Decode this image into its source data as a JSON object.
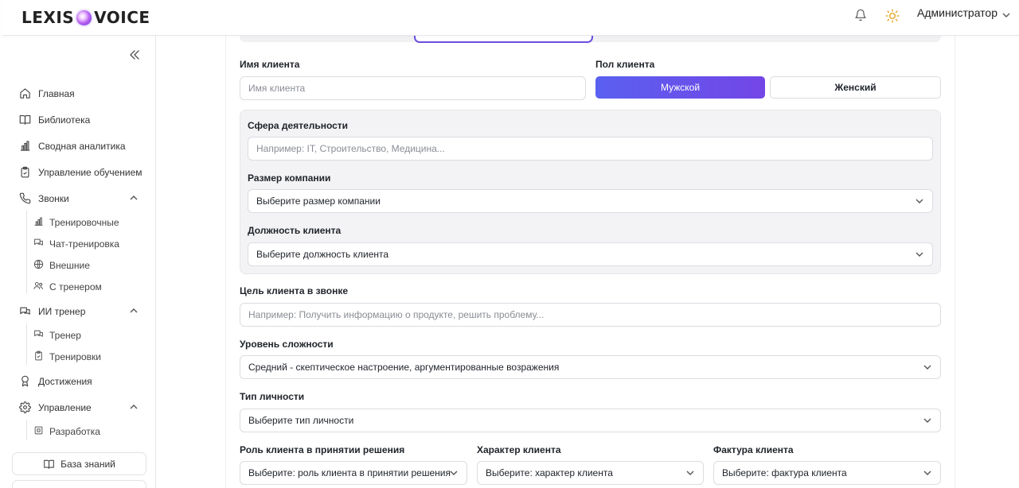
{
  "header": {
    "logo_left": "LEXIS",
    "logo_right": "VOICE",
    "user_name": "Администратор"
  },
  "sidebar": {
    "items": [
      {
        "label": "Главная",
        "icon": "home-icon"
      },
      {
        "label": "Библиотека",
        "icon": "book-icon"
      },
      {
        "label": "Сводная аналитика",
        "icon": "chart-icon"
      },
      {
        "label": "Управление обучением",
        "icon": "clipboard-icon"
      },
      {
        "label": "Звонки",
        "icon": "phone-icon"
      },
      {
        "label": "ИИ тренер",
        "icon": "chat-icon"
      },
      {
        "label": "Достижения",
        "icon": "award-icon"
      },
      {
        "label": "Управление",
        "icon": "gear-icon"
      }
    ],
    "calls_sub": [
      "Тренировочные",
      "Чат-тренировка",
      "Внешние",
      "С тренером"
    ],
    "ai_sub": [
      "Тренер",
      "Тренировки"
    ],
    "manage_sub": [
      "Разработка"
    ],
    "knowledge_base": "База знаний"
  },
  "form": {
    "client_name_label": "Имя клиента",
    "client_name_placeholder": "Имя клиента",
    "gender_label": "Пол клиента",
    "gender_male": "Мужской",
    "gender_female": "Женский",
    "industry_label": "Сфера деятельности",
    "industry_placeholder": "Например: IT, Строительство, Медицина...",
    "company_size_label": "Размер компании",
    "company_size_value": "Выберите размер компании",
    "position_label": "Должность клиента",
    "position_value": "Выберите должность клиента",
    "goal_label": "Цель клиента в звонке",
    "goal_placeholder": "Например: Получить информацию о продукте, решить проблему...",
    "difficulty_label": "Уровень сложности",
    "difficulty_value": "Средний - скептическое настроение, аргументированные возражения",
    "personality_label": "Тип личности",
    "personality_value": "Выберите тип личности",
    "role_label": "Роль клиента в принятии решения",
    "role_value": "Выберите: роль клиента в принятии решения",
    "character_label": "Характер клиента",
    "character_value": "Выберите: характер клиента",
    "texture_label": "Фактура клиента",
    "texture_value": "Выберите: фактура клиента"
  },
  "colors": {
    "accent_start": "#5a60f0",
    "accent_end": "#7346e6"
  }
}
